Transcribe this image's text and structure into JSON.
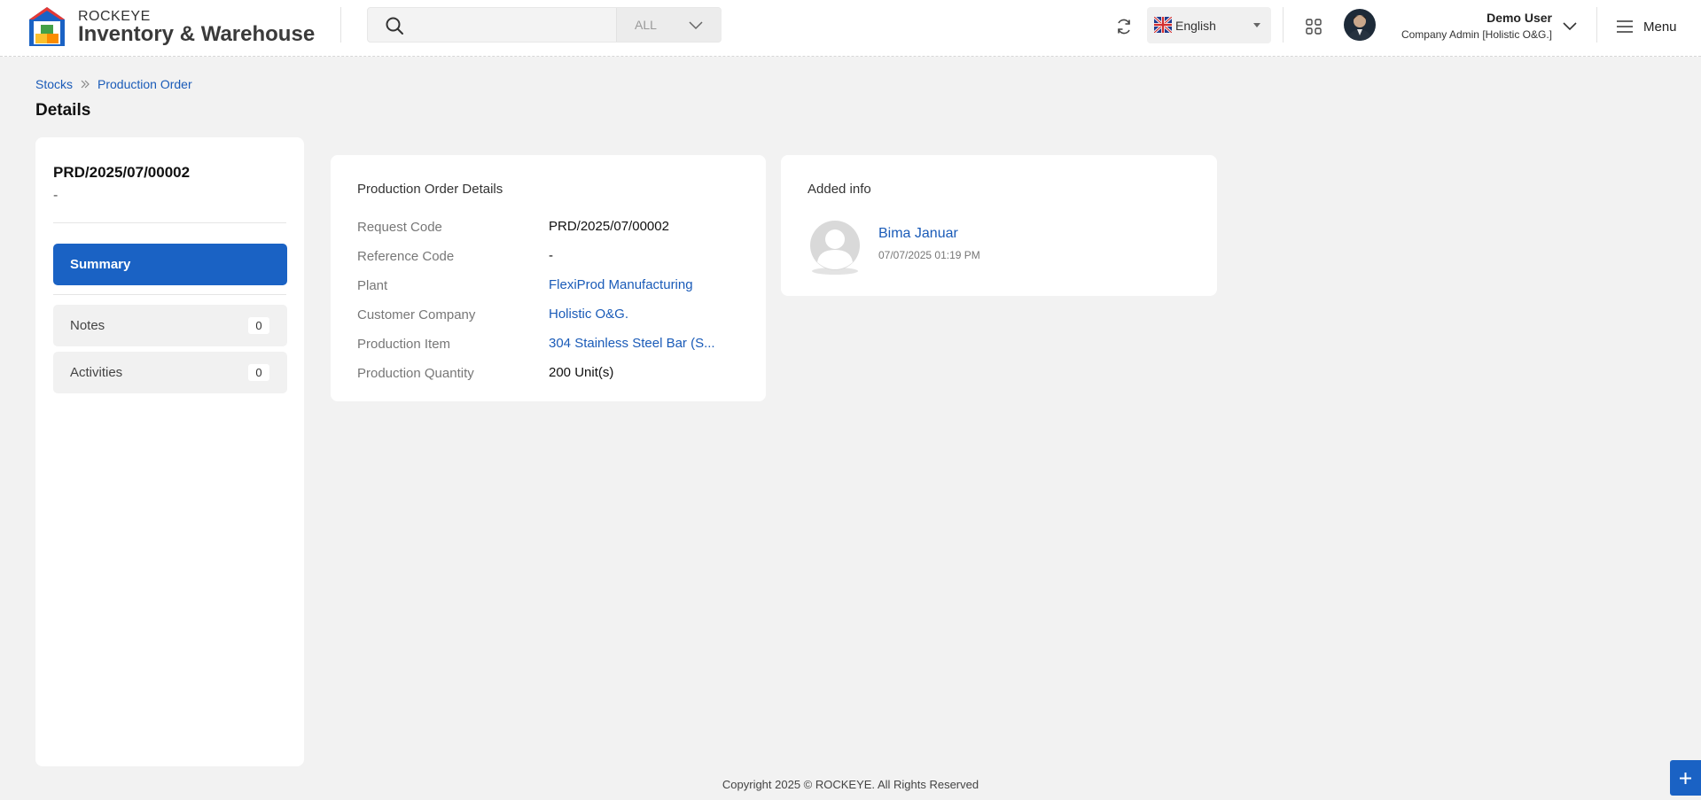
{
  "header": {
    "brand_top": "ROCKEYE",
    "brand_main": "Inventory & Warehouse",
    "search": {
      "placeholder": "",
      "scope": "ALL"
    },
    "language": "English",
    "user": {
      "name": "Demo User",
      "role": "Company Admin [Holistic O&G.]"
    },
    "menu_label": "Menu"
  },
  "breadcrumb": [
    "Stocks",
    "Production Order"
  ],
  "page_title": "Details",
  "record": {
    "code": "PRD/2025/07/00002",
    "subtitle": "-"
  },
  "nav": [
    {
      "label": "Summary",
      "count": null,
      "active": true
    },
    {
      "label": "Notes",
      "count": "0",
      "active": false
    },
    {
      "label": "Activities",
      "count": "0",
      "active": false
    }
  ],
  "details": {
    "title": "Production Order Details",
    "fields": [
      {
        "label": "Request Code",
        "value": "PRD/2025/07/00002",
        "link": false
      },
      {
        "label": "Reference Code",
        "value": "-",
        "link": false
      },
      {
        "label": "Plant",
        "value": "FlexiProd Manufacturing",
        "link": true
      },
      {
        "label": "Customer Company",
        "value": "Holistic O&G.",
        "link": true
      },
      {
        "label": "Production Item",
        "value": "304 Stainless Steel Bar (S...",
        "link": true
      },
      {
        "label": "Production Quantity",
        "value": "200 Unit(s)",
        "link": false
      }
    ]
  },
  "added_info": {
    "title": "Added info",
    "name": "Bima Januar",
    "datetime": "07/07/2025 01:19 PM"
  },
  "footer": {
    "copyright": "Copyright 2025 © ROCKEYE. All Rights Reserved"
  },
  "colors": {
    "primary": "#1a62c4",
    "link": "#1a5bb8",
    "background": "#f2f2f2"
  },
  "icons": [
    "rockeye-logo-icon",
    "search-icon",
    "chevron-down-icon",
    "refresh-icon",
    "uk-flag-icon",
    "caret-down-icon",
    "apps-grid-icon",
    "hamburger-menu-icon",
    "chevron-right-double-icon",
    "user-placeholder-icon",
    "plus-icon"
  ]
}
